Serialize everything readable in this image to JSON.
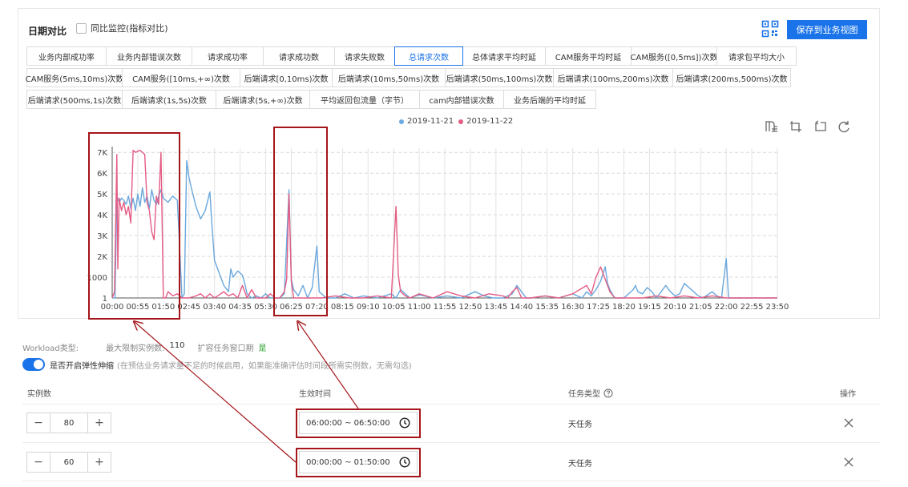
{
  "header": {
    "title": "日期对比",
    "compare_label": "同比监控(指标对比)",
    "save_button": "保存到业务视图"
  },
  "tabs": [
    [
      "业务内部成功率",
      "业务内部错误次数",
      "请求成功率",
      "请求成功数",
      "请求失败数",
      "总请求次数",
      "总体请求平均时延",
      "CAM服务平均时延",
      "CAM服务([0,5ms])次数",
      "请求包平均大小"
    ],
    [
      "CAM服务(5ms,10ms)次数",
      "CAM服务([10ms,+∞)次数",
      "后端请求[0,10ms)次数",
      "后端请求(10ms,50ms)次数",
      "后端请求(50ms,100ms)次数",
      "后端请求(100ms,200ms)次数",
      "后端请求(200ms,500ms)次数"
    ],
    [
      "后端请求(500ms,1s)次数",
      "后端请求(1s,5s)次数",
      "后端请求(5s,+∞)次数",
      "平均返回包流量（字节）",
      "cam内部错误次数",
      "业务后端的平均时延"
    ]
  ],
  "active_tab": "总请求次数",
  "chart_data": {
    "type": "line",
    "series": [
      {
        "name": "2019-11-21",
        "color": "#6aa8dd",
        "points": [
          [
            "00:00",
            1
          ],
          [
            "00:06",
            1
          ],
          [
            "00:10",
            4900
          ],
          [
            "00:15",
            4600
          ],
          [
            "00:20",
            4800
          ],
          [
            "00:25",
            4700
          ],
          [
            "00:30",
            4500
          ],
          [
            "00:35",
            4900
          ],
          [
            "00:40",
            4300
          ],
          [
            "00:45",
            4800
          ],
          [
            "00:50",
            4200
          ],
          [
            "00:55",
            5000
          ],
          [
            "01:00",
            4400
          ],
          [
            "01:05",
            5300
          ],
          [
            "01:10",
            4600
          ],
          [
            "01:15",
            4900
          ],
          [
            "01:20",
            4300
          ],
          [
            "01:25",
            5200
          ],
          [
            "01:30",
            4700
          ],
          [
            "01:35",
            4500
          ],
          [
            "01:40",
            4900
          ],
          [
            "01:45",
            5200
          ],
          [
            "01:50",
            4800
          ],
          [
            "02:00",
            4600
          ],
          [
            "02:10",
            4900
          ],
          [
            "02:20",
            4700
          ],
          [
            "02:30",
            1
          ],
          [
            "02:35",
            200
          ],
          [
            "02:40",
            6600
          ],
          [
            "02:45",
            5800
          ],
          [
            "02:50",
            5300
          ],
          [
            "03:00",
            4400
          ],
          [
            "03:10",
            3800
          ],
          [
            "03:20",
            4200
          ],
          [
            "03:30",
            5100
          ],
          [
            "03:35",
            3300
          ],
          [
            "03:40",
            1800
          ],
          [
            "03:50",
            1200
          ],
          [
            "04:00",
            600
          ],
          [
            "04:10",
            300
          ],
          [
            "04:15",
            1400
          ],
          [
            "04:20",
            1000
          ],
          [
            "04:30",
            1300
          ],
          [
            "04:40",
            1100
          ],
          [
            "04:45",
            700
          ],
          [
            "04:50",
            200
          ],
          [
            "05:00",
            1
          ],
          [
            "05:10",
            100
          ],
          [
            "05:20",
            1
          ],
          [
            "05:30",
            200
          ],
          [
            "05:40",
            1
          ],
          [
            "06:00",
            1
          ],
          [
            "06:10",
            200
          ],
          [
            "06:20",
            5200
          ],
          [
            "06:25",
            900
          ],
          [
            "06:30",
            400
          ],
          [
            "06:40",
            100
          ],
          [
            "06:50",
            600
          ],
          [
            "07:00",
            1
          ],
          [
            "07:10",
            500
          ],
          [
            "07:20",
            2500
          ],
          [
            "07:25",
            300
          ],
          [
            "07:35",
            100
          ],
          [
            "07:40",
            1
          ],
          [
            "08:00",
            1
          ],
          [
            "08:20",
            200
          ],
          [
            "08:40",
            1
          ],
          [
            "09:00",
            100
          ],
          [
            "09:30",
            1
          ],
          [
            "10:00",
            200
          ],
          [
            "10:10",
            1
          ],
          [
            "10:20",
            400
          ],
          [
            "10:30",
            200
          ],
          [
            "10:40",
            1
          ],
          [
            "11:00",
            150
          ],
          [
            "11:30",
            1
          ],
          [
            "12:00",
            100
          ],
          [
            "12:30",
            1
          ],
          [
            "13:00",
            300
          ],
          [
            "13:20",
            100
          ],
          [
            "13:40",
            1
          ],
          [
            "14:00",
            1
          ],
          [
            "14:20",
            200
          ],
          [
            "14:30",
            600
          ],
          [
            "14:40",
            300
          ],
          [
            "14:50",
            1
          ],
          [
            "15:00",
            1
          ],
          [
            "15:30",
            100
          ],
          [
            "16:00",
            1
          ],
          [
            "16:30",
            200
          ],
          [
            "16:50",
            1
          ],
          [
            "17:00",
            300
          ],
          [
            "17:10",
            100
          ],
          [
            "17:20",
            400
          ],
          [
            "17:30",
            800
          ],
          [
            "17:40",
            1500
          ],
          [
            "17:45",
            700
          ],
          [
            "17:50",
            400
          ],
          [
            "18:00",
            1
          ],
          [
            "18:20",
            1
          ],
          [
            "18:40",
            400
          ],
          [
            "18:45",
            600
          ],
          [
            "18:50",
            300
          ],
          [
            "19:00",
            200
          ],
          [
            "19:10",
            500
          ],
          [
            "19:20",
            300
          ],
          [
            "19:30",
            1
          ],
          [
            "19:40",
            300
          ],
          [
            "19:50",
            600
          ],
          [
            "20:00",
            300
          ],
          [
            "20:10",
            100
          ],
          [
            "20:20",
            200
          ],
          [
            "20:30",
            700
          ],
          [
            "20:40",
            500
          ],
          [
            "20:50",
            300
          ],
          [
            "21:00",
            100
          ],
          [
            "21:10",
            1
          ],
          [
            "21:30",
            300
          ],
          [
            "21:40",
            100
          ],
          [
            "21:50",
            1
          ],
          [
            "22:00",
            1900
          ],
          [
            "22:05",
            1
          ],
          [
            "22:30",
            1
          ],
          [
            "23:00",
            1
          ],
          [
            "23:50",
            1
          ]
        ]
      },
      {
        "name": "2019-11-22",
        "color": "#e45c84",
        "points": [
          [
            "00:00",
            1
          ],
          [
            "00:05",
            300
          ],
          [
            "00:10",
            6900
          ],
          [
            "00:12",
            1400
          ],
          [
            "00:15",
            4800
          ],
          [
            "00:20",
            4200
          ],
          [
            "00:25",
            4600
          ],
          [
            "00:30",
            4000
          ],
          [
            "00:35",
            4400
          ],
          [
            "00:40",
            3600
          ],
          [
            "00:45",
            7100
          ],
          [
            "00:50",
            7000
          ],
          [
            "01:00",
            7100
          ],
          [
            "01:10",
            6900
          ],
          [
            "01:15",
            4600
          ],
          [
            "01:20",
            4200
          ],
          [
            "01:25",
            3200
          ],
          [
            "01:30",
            2800
          ],
          [
            "01:35",
            4900
          ],
          [
            "01:40",
            4500
          ],
          [
            "01:45",
            7000
          ],
          [
            "01:50",
            1
          ],
          [
            "01:55",
            1
          ],
          [
            "02:00",
            300
          ],
          [
            "02:10",
            100
          ],
          [
            "02:20",
            200
          ],
          [
            "02:30",
            1
          ],
          [
            "02:45",
            1
          ],
          [
            "03:00",
            100
          ],
          [
            "03:10",
            200
          ],
          [
            "03:20",
            1
          ],
          [
            "03:30",
            200
          ],
          [
            "03:40",
            1
          ],
          [
            "04:00",
            300
          ],
          [
            "04:10",
            100
          ],
          [
            "04:20",
            200
          ],
          [
            "04:30",
            1
          ],
          [
            "04:40",
            600
          ],
          [
            "04:45",
            300
          ],
          [
            "04:50",
            1
          ],
          [
            "05:00",
            400
          ],
          [
            "05:10",
            1
          ],
          [
            "05:20",
            1
          ],
          [
            "05:30",
            1
          ],
          [
            "05:40",
            200
          ],
          [
            "05:50",
            1
          ],
          [
            "06:00",
            1
          ],
          [
            "06:10",
            300
          ],
          [
            "06:15",
            900
          ],
          [
            "06:20",
            5000
          ],
          [
            "06:25",
            800
          ],
          [
            "06:30",
            1
          ],
          [
            "07:00",
            1
          ],
          [
            "07:30",
            1
          ],
          [
            "08:00",
            100
          ],
          [
            "08:30",
            1
          ],
          [
            "09:00",
            1
          ],
          [
            "09:30",
            100
          ],
          [
            "10:00",
            1
          ],
          [
            "10:10",
            4400
          ],
          [
            "10:15",
            1100
          ],
          [
            "10:20",
            300
          ],
          [
            "10:30",
            100
          ],
          [
            "10:40",
            1
          ],
          [
            "11:00",
            200
          ],
          [
            "11:30",
            1
          ],
          [
            "12:00",
            300
          ],
          [
            "12:30",
            100
          ],
          [
            "13:00",
            1
          ],
          [
            "13:30",
            200
          ],
          [
            "14:00",
            100
          ],
          [
            "14:10",
            1
          ],
          [
            "14:20",
            300
          ],
          [
            "14:30",
            500
          ],
          [
            "14:40",
            1
          ],
          [
            "15:00",
            1
          ],
          [
            "15:30",
            100
          ],
          [
            "16:00",
            1
          ],
          [
            "16:30",
            200
          ],
          [
            "17:00",
            600
          ],
          [
            "17:10",
            200
          ],
          [
            "17:20",
            1000
          ],
          [
            "17:30",
            1500
          ],
          [
            "17:40",
            900
          ],
          [
            "17:50",
            300
          ],
          [
            "18:00",
            1
          ],
          [
            "18:30",
            1
          ],
          [
            "19:00",
            1
          ],
          [
            "19:30",
            100
          ],
          [
            "20:00",
            1
          ],
          [
            "20:30",
            100
          ],
          [
            "21:00",
            1
          ],
          [
            "21:30",
            100
          ],
          [
            "22:00",
            1
          ],
          [
            "22:30",
            1
          ],
          [
            "23:00",
            1
          ],
          [
            "23:50",
            1
          ]
        ]
      }
    ],
    "y_ticks": [
      "1",
      "1000",
      "2K",
      "3K",
      "4K",
      "5K",
      "6K",
      "7K"
    ],
    "x_ticks": [
      "00:00",
      "00:55",
      "01:50",
      "02:45",
      "03:40",
      "04:35",
      "05:30",
      "06:25",
      "07:20",
      "08:15",
      "09:10",
      "10:05",
      "11:00",
      "11:55",
      "12:50",
      "13:45",
      "14:40",
      "15:35",
      "16:30",
      "17:25",
      "18:20",
      "19:15",
      "20:10",
      "21:05",
      "22:00",
      "22:55",
      "23:50"
    ],
    "ylim": [
      0,
      7200
    ],
    "xlim": [
      "00:00",
      "23:50"
    ],
    "grid": true,
    "legend": "top-center"
  },
  "workload": {
    "type_label": "Workload类型:",
    "max_label": "最大限制实例数:",
    "max_value": "110",
    "window_label": "扩容任务窗口期",
    "window_value": "是"
  },
  "toggle": {
    "label": "是否开启弹性伸缩",
    "hint": "(在预估业务请求量不足的时候启用，如果能准确评估时间段所需实例数，无需勾选)"
  },
  "table": {
    "col_instances": "实例数",
    "col_effective_time": "生效时间",
    "col_task_type": "任务类型",
    "col_ops": "操作",
    "rows": [
      {
        "instances": "80",
        "time": "06:00:00 ~ 06:50:00",
        "task_type": "天任务"
      },
      {
        "instances": "60",
        "time": "00:00:00 ~ 01:50:00",
        "task_type": "天任务"
      }
    ]
  },
  "icons": {
    "qr": "qr-code-icon",
    "tools": [
      "data-view-icon",
      "area-zoom-icon",
      "zoom-reset-icon",
      "restore-icon"
    ],
    "help": "help-circle-icon",
    "clock": "clock-icon",
    "close": "close-icon"
  },
  "colors": {
    "accent": "#1a73e8",
    "series_a": "#6aa8dd",
    "series_b": "#e45c84",
    "annotation": "#a4161a"
  }
}
